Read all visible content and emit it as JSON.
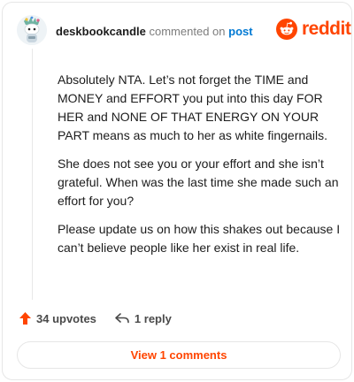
{
  "comment": {
    "author": "deskbookcandle",
    "action_text": "commented on",
    "target_link": "post",
    "paragraphs": [
      "Absolutely NTA. Let’s not forget the TIME and MONEY and EFFORT you put into this day FOR HER and NONE OF THAT ENERGY ON YOUR PART means as much to her as white fingernails.",
      "She does not see you or your effort and she isn’t grateful. When was the last time she made such an effort for you?",
      "Please update us on how this shakes out because I can’t believe people like her exist in real life."
    ]
  },
  "brand": {
    "wordmark": "reddit",
    "color": "#ff4500"
  },
  "actions": {
    "upvotes_label": "34 upvotes",
    "reply_label": "1 reply",
    "view_comments_label": "View 1 comments"
  },
  "icons": {
    "upvote": "upvote-arrow-icon",
    "reply": "reply-arrow-icon",
    "logo": "reddit-snoo-icon"
  },
  "colors": {
    "accent": "#ff4500",
    "link": "#0079d3",
    "text": "#1c1c1c"
  }
}
